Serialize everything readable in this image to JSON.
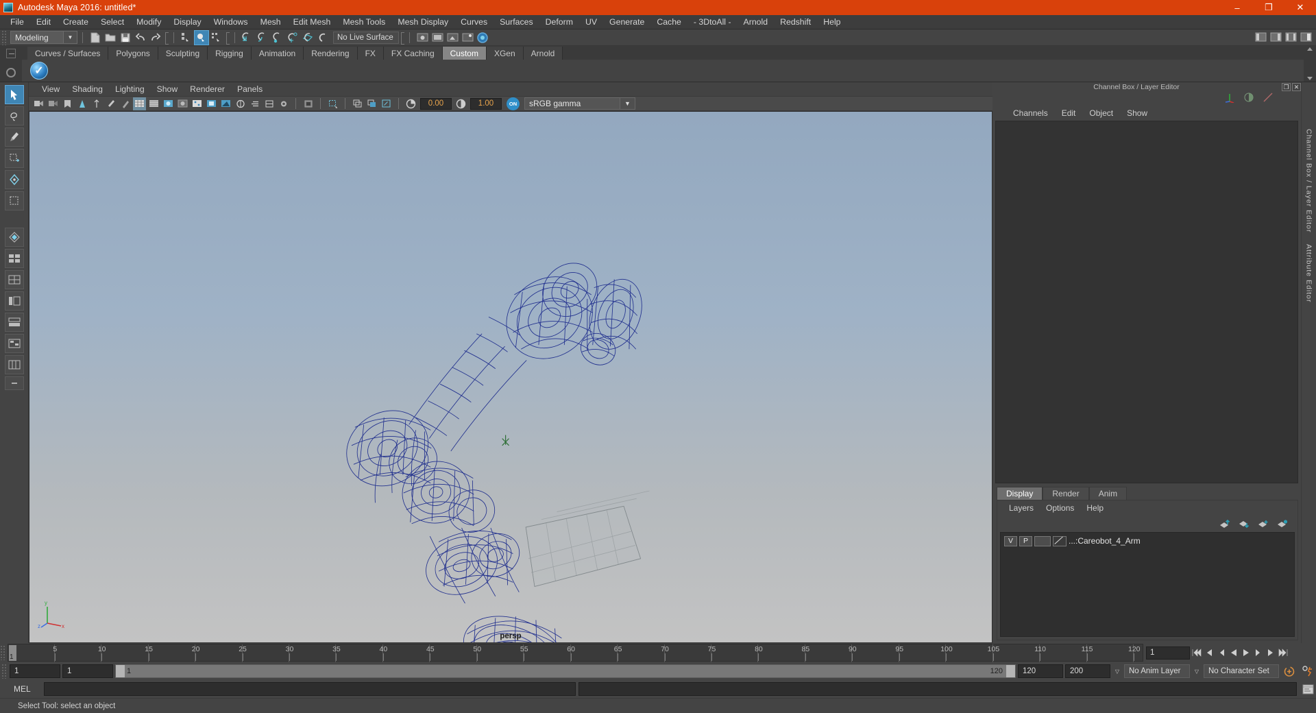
{
  "window": {
    "title": "Autodesk Maya 2016: untitled*",
    "minimize": "–",
    "maximize": "❐",
    "close": "✕"
  },
  "menubar": {
    "items": [
      "File",
      "Edit",
      "Create",
      "Select",
      "Modify",
      "Display",
      "Windows",
      "Mesh",
      "Edit Mesh",
      "Mesh Tools",
      "Mesh Display",
      "Curves",
      "Surfaces",
      "Deform",
      "UV",
      "Generate",
      "Cache",
      "- 3DtoAll -",
      "Arnold",
      "Redshift",
      "Help"
    ]
  },
  "statusline": {
    "mode": "Modeling",
    "mode_arrow": "▼",
    "live_surface": "No Live Surface"
  },
  "shelf": {
    "tabs": [
      "Curves / Surfaces",
      "Polygons",
      "Sculpting",
      "Rigging",
      "Animation",
      "Rendering",
      "FX",
      "FX Caching",
      "Custom",
      "XGen",
      "Arnold"
    ],
    "active_tab": "Custom",
    "icon_name": "blue-checkmark-shelf-icon"
  },
  "viewport": {
    "menus": [
      "View",
      "Shading",
      "Lighting",
      "Show",
      "Renderer",
      "Panels"
    ],
    "exposure": "0.00",
    "gamma_value": "1.00",
    "color_space": "sRGB gamma",
    "color_space_arrow": "▼",
    "on_label": "ON",
    "camera_label": "persp",
    "axis_x": "x",
    "axis_y": "y",
    "axis_z": "z"
  },
  "channelbox": {
    "title": "Channel Box / Layer Editor",
    "restore_glyph": "❐",
    "close_glyph": "✕",
    "menus": [
      "Channels",
      "Edit",
      "Object",
      "Show"
    ]
  },
  "layer_editor": {
    "tabs": [
      "Display",
      "Render",
      "Anim"
    ],
    "active_tab": "Display",
    "menus": [
      "Layers",
      "Options",
      "Help"
    ],
    "rows": [
      {
        "visibility": "V",
        "playback": "P",
        "name": "...:Careobot_4_Arm"
      }
    ]
  },
  "right_vtabs": [
    "Channel Box / Layer Editor",
    "Attribute Editor"
  ],
  "timeline": {
    "ticks": [
      "5",
      "10",
      "15",
      "20",
      "25",
      "30",
      "35",
      "40",
      "45",
      "50",
      "55",
      "60",
      "65",
      "70",
      "75",
      "80",
      "85",
      "90",
      "95",
      "100",
      "105",
      "110",
      "115",
      "120"
    ],
    "current_frame_marker": "1",
    "current_frame_field": "1"
  },
  "range": {
    "start": "1",
    "end": "1",
    "bar_left": "1",
    "bar_right": "120",
    "range_end": "120",
    "playback_end": "200",
    "anim_layer": "No Anim Layer",
    "character_set": "No Character Set",
    "arrow": "▽"
  },
  "mel": {
    "label": "MEL",
    "input_value": "",
    "output_value": ""
  },
  "helpline": {
    "text": "Select Tool: select an object"
  },
  "colors": {
    "titlebar": "#d9410b",
    "chrome": "#444444",
    "accent_blue": "#3f86b5",
    "wireframe": "#1c2a8a",
    "field_orange": "#e8a44c"
  }
}
